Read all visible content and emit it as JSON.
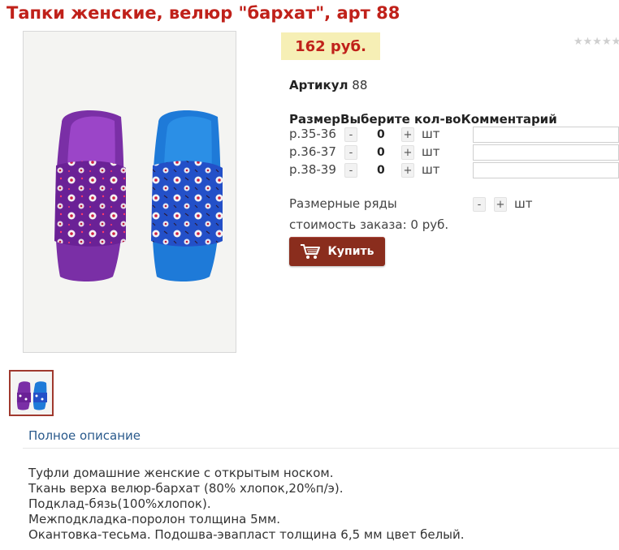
{
  "product": {
    "title": "Тапки женские, велюр \"бархат\", арт 88",
    "price": "162 руб.",
    "rating_stars": "★★★★★",
    "sku_label": "Артикул",
    "sku_value": "88"
  },
  "order_table": {
    "headers": [
      "Размер",
      "Выберите кол-во",
      "Комментарий"
    ],
    "rows": [
      {
        "size": "р.35-36",
        "minus": "-",
        "qty": "0",
        "plus": "+",
        "unit": "шт",
        "comment": ""
      },
      {
        "size": "р.36-37",
        "minus": "-",
        "qty": "0",
        "plus": "+",
        "unit": "шт",
        "comment": ""
      },
      {
        "size": "р.38-39",
        "minus": "-",
        "qty": "0",
        "plus": "+",
        "unit": "шт",
        "comment": ""
      }
    ]
  },
  "size_ranges": {
    "label": "Размерные ряды",
    "minus": "-",
    "plus": "+",
    "unit": "шт"
  },
  "order_cost": "стоимость заказа: 0 руб.",
  "buy_button": {
    "label": "Купить",
    "icon": "cart-icon"
  },
  "tabs": {
    "full_description": "Полное описание"
  },
  "description": [
    "Туфли домашние женские с открытым носком.",
    "Ткань верха велюр-бархат (80% хлопок,20%п/э).",
    "Подклад-бязь(100%хлопок).",
    "Межподкладка-поролон толщина 5мм.",
    "Окантовка-тесьма. Подошва-эвапласт толщина 6,5 мм цвет белый."
  ],
  "colors": {
    "title": "#c0211a",
    "price_bg": "#f6efb5",
    "buy_button": "#8a2d1d",
    "link": "#2a5a8c"
  }
}
